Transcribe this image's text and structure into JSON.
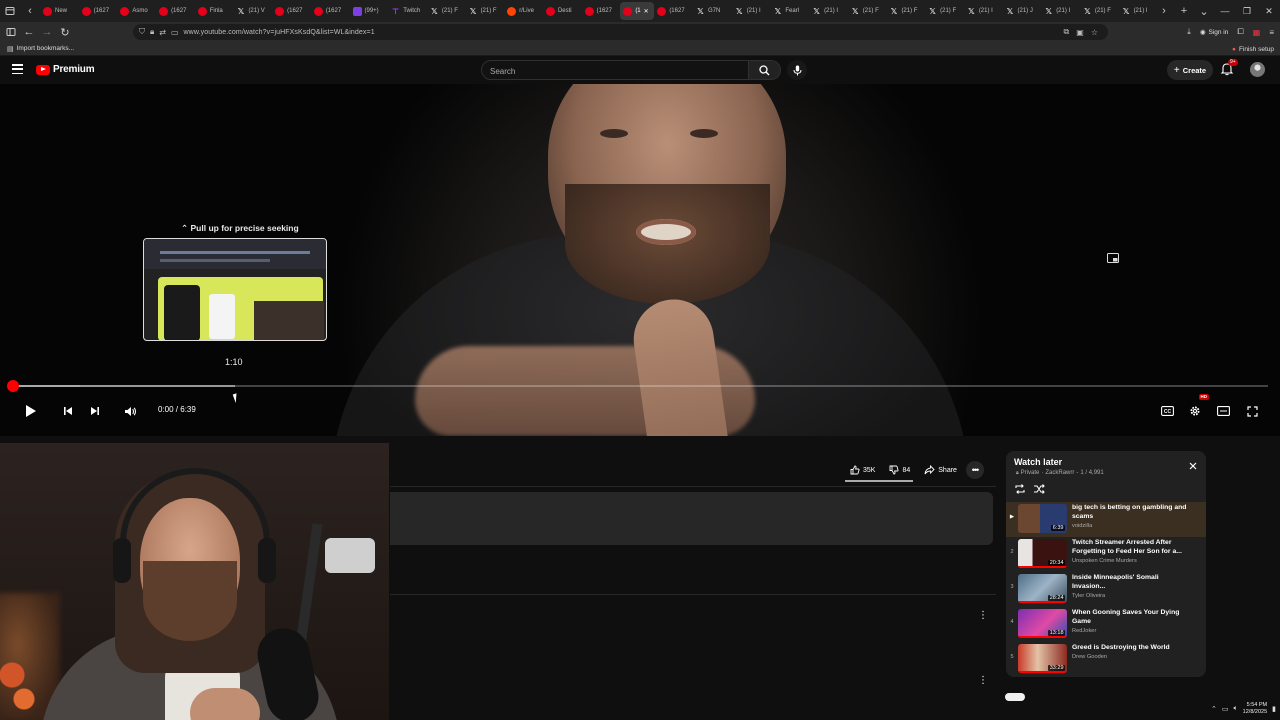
{
  "browser": {
    "tabs": [
      {
        "title": "New",
        "icon": "fav-red"
      },
      {
        "title": "(1627",
        "icon": "fav-red"
      },
      {
        "title": "Asmo",
        "icon": "fav-red"
      },
      {
        "title": "(1627",
        "icon": "fav-red"
      },
      {
        "title": "Finla",
        "icon": "fav-red"
      },
      {
        "title": "(21) V",
        "icon": "fav-x"
      },
      {
        "title": "(1627",
        "icon": "fav-red"
      },
      {
        "title": "(1627",
        "icon": "fav-red"
      },
      {
        "title": "(99+)",
        "icon": "fav-purple"
      },
      {
        "title": "Twitch",
        "icon": "fav-twitch"
      },
      {
        "title": "(21) F",
        "icon": "fav-x"
      },
      {
        "title": "(21) F",
        "icon": "fav-x"
      },
      {
        "title": "r/Live",
        "icon": "fav-reddit"
      },
      {
        "title": "Desti",
        "icon": "fav-red"
      },
      {
        "title": "(1627",
        "icon": "fav-red"
      },
      {
        "title": "(1",
        "icon": "fav-red",
        "active": true
      },
      {
        "title": "(1627",
        "icon": "fav-red"
      },
      {
        "title": "G7N",
        "icon": "fav-x"
      },
      {
        "title": "(21) I",
        "icon": "fav-x"
      },
      {
        "title": "Fearl",
        "icon": "fav-x"
      },
      {
        "title": "(21) I",
        "icon": "fav-x"
      },
      {
        "title": "(21) F",
        "icon": "fav-x"
      },
      {
        "title": "(21) F",
        "icon": "fav-x"
      },
      {
        "title": "(21) F",
        "icon": "fav-x"
      },
      {
        "title": "(21) I",
        "icon": "fav-x"
      },
      {
        "title": "(21) J",
        "icon": "fav-x"
      },
      {
        "title": "(21) I",
        "icon": "fav-x"
      },
      {
        "title": "(21) F",
        "icon": "fav-x"
      },
      {
        "title": "(21) I",
        "icon": "fav-x"
      }
    ],
    "url": "www.youtube.com/watch?v=juHFXsKsdQ&list=WL&index=1",
    "sign_in": "Sign in",
    "bookmarks": {
      "import": "Import bookmarks...",
      "finish_setup": "Finish setup"
    }
  },
  "youtube": {
    "logo_text": "Premium",
    "search_placeholder": "Search",
    "create_label": "Create",
    "notification_badge": "9+",
    "player": {
      "seek_hint": "Pull up for precise seeking",
      "hover_time": "1:10",
      "time_display": "0:00 / 6:39",
      "hd_badge": "HD"
    },
    "actions": {
      "likes": "35K",
      "dislikes": "84",
      "share": "Share"
    },
    "playlist": {
      "title": "Watch later",
      "privacy": "Private",
      "owner": "ZackRawrr",
      "position": "1 / 4,991",
      "items": [
        {
          "index": "▶",
          "title": "big tech is betting on gambling and scams",
          "channel": "voidzilla",
          "duration": "6:39",
          "thumb": "linear-gradient(90deg,#6b4631 0 45%,#2a3b70 45% 100%)",
          "current": true,
          "watched": 0
        },
        {
          "index": "2",
          "title": "Twitch Streamer Arrested After Forgetting to Feed Her Son for a...",
          "channel": "Unspoken Crime Murders",
          "duration": "20:34",
          "thumb": "linear-gradient(90deg,#e8e4e2 0 30%,#3a1310 30% 100%)",
          "current": false,
          "watched": 1
        },
        {
          "index": "3",
          "title": "Inside Minneapolis' Somali Invasion...",
          "channel": "Tyler Oliveira",
          "duration": "28:24",
          "thumb": "linear-gradient(135deg,#4f6e86 0%,#9db4c7 50%,#3b4d5a 100%)",
          "current": false,
          "watched": 1
        },
        {
          "index": "4",
          "title": "When Gooning Saves Your Dying Game",
          "channel": "RedJoker",
          "duration": "13:18",
          "thumb": "linear-gradient(135deg,#7b2fb2 0%,#e04aa5 55%,#2a4fb0 100%)",
          "current": false,
          "watched": 1
        },
        {
          "index": "5",
          "title": "Greed is Destroying the World",
          "channel": "Drew Gooden",
          "duration": "33:29",
          "thumb": "linear-gradient(90deg,#c93a2a 0%,#e3c3a5 40%,#8c2a22 100%)",
          "current": false,
          "watched": 1
        }
      ]
    }
  },
  "taskbar": {
    "time": "5:54 PM",
    "date": "12/8/2025"
  }
}
